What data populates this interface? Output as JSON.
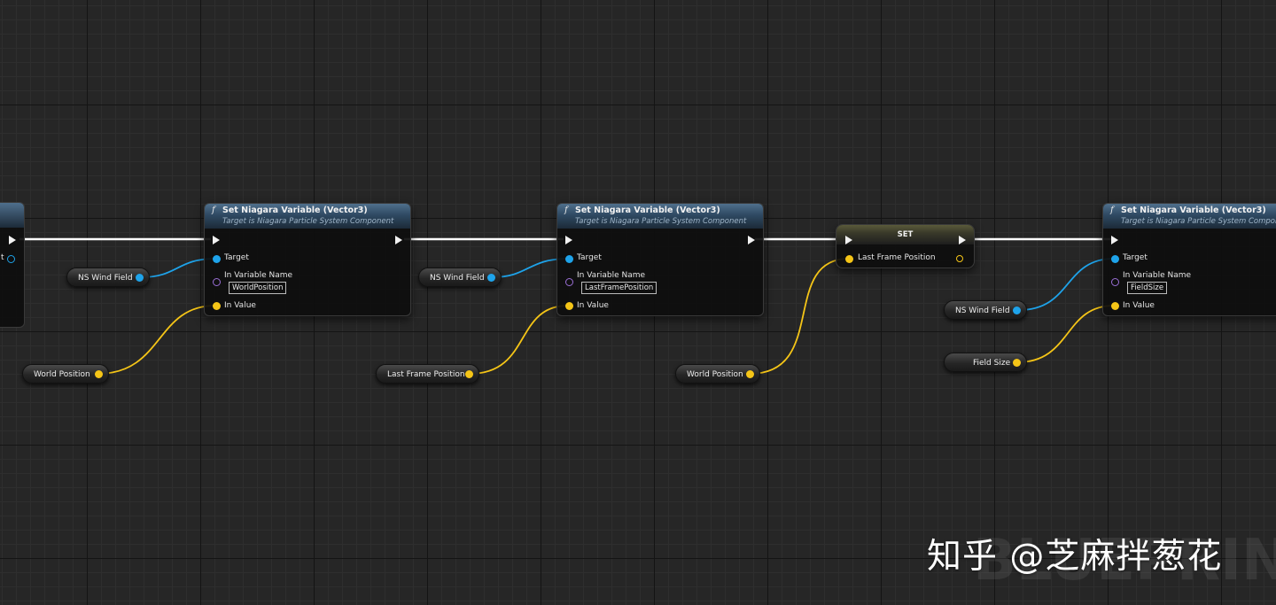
{
  "colors": {
    "exec_wire": "#ffffff",
    "object_wire": "#1ea3ea",
    "vector_wire": "#f5c517",
    "name_pin": "#9a6fd6",
    "function_header": "#3f5d78"
  },
  "left_node": {
    "output_label": "t"
  },
  "nodes": [
    {
      "title": "Set Niagara Variable (Vector3)",
      "subtitle": "Target is Niagara Particle System Component",
      "target_label": "Target",
      "variable_name_label": "In Variable Name",
      "variable_name_value": "WorldPosition",
      "value_label": "In Value"
    },
    {
      "title": "Set Niagara Variable (Vector3)",
      "subtitle": "Target is Niagara Particle System Component",
      "target_label": "Target",
      "variable_name_label": "In Variable Name",
      "variable_name_value": "LastFramePosition",
      "value_label": "In Value"
    },
    {
      "title": "Set Niagara Variable (Vector3)",
      "subtitle": "Target is Niagara Particle System Compone",
      "target_label": "Target",
      "variable_name_label": "In Variable Name",
      "variable_name_value": "FieldSize",
      "value_label": "In Value"
    }
  ],
  "set_node": {
    "title": "SET",
    "pin_label": "Last Frame Position"
  },
  "variables": [
    {
      "label": "NS Wind Field"
    },
    {
      "label": "World Position"
    },
    {
      "label": "NS Wind Field"
    },
    {
      "label": "Last Frame Position"
    },
    {
      "label": "World Position"
    },
    {
      "label": "NS Wind Field"
    },
    {
      "label": "Field Size"
    }
  ],
  "watermark": {
    "text": "知乎 @芝麻拌葱花",
    "background_text": "BLUEPRINT"
  }
}
